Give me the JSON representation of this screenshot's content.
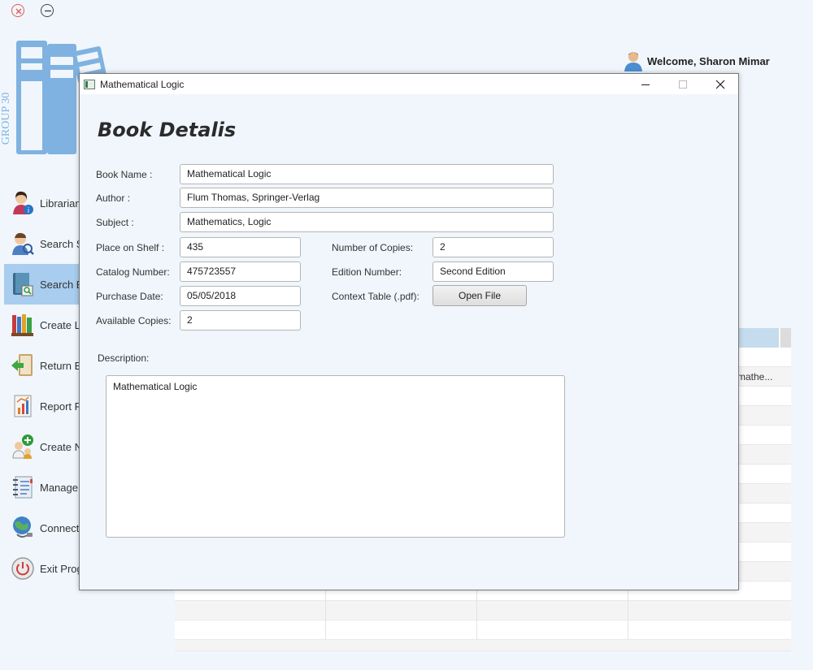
{
  "app": {
    "logo_text": "GROUP 30",
    "welcome": "Welcome, Sharon Mimar",
    "sidebar": [
      {
        "label": "Librarian",
        "icon": "librarian-info-icon",
        "active": false
      },
      {
        "label": "Search Su",
        "icon": "search-user-icon",
        "active": false
      },
      {
        "label": "Search Bo",
        "icon": "search-book-icon",
        "active": true
      },
      {
        "label": "Create Lo",
        "icon": "books-shelf-icon",
        "active": false
      },
      {
        "label": "Return Bo",
        "icon": "return-book-icon",
        "active": false
      },
      {
        "label": "Report Fa",
        "icon": "report-chart-icon",
        "active": false
      },
      {
        "label": "Create Ne",
        "icon": "create-user-icon",
        "active": false
      },
      {
        "label": "Manage (",
        "icon": "notebook-icon",
        "active": false
      },
      {
        "label": "Connecti",
        "icon": "connection-globe-icon",
        "active": false
      },
      {
        "label": "Exit Progr",
        "icon": "power-icon",
        "active": false
      }
    ],
    "table_partial_text": "mathe..."
  },
  "dialog": {
    "title": "Mathematical Logic",
    "heading": "Book Detalis",
    "fields": {
      "book_name": {
        "label": "Book Name :",
        "value": "Mathematical Logic"
      },
      "author": {
        "label": "Author :",
        "value": "Flum Thomas, Springer-Verlag"
      },
      "subject": {
        "label": "Subject :",
        "value": "Mathematics, Logic"
      },
      "place_on_shelf": {
        "label": "Place on Shelf :",
        "value": "435"
      },
      "catalog_number": {
        "label": "Catalog Number:",
        "value": "475723557"
      },
      "purchase_date": {
        "label": "Purchase Date:",
        "value": "05/05/2018"
      },
      "available_copies": {
        "label": "Available Copies:",
        "value": "2"
      },
      "number_of_copies": {
        "label": "Number of Copies:",
        "value": "2"
      },
      "edition_number": {
        "label": "Edition Number:",
        "value": "Second Edition"
      },
      "context_table": {
        "label": "Context Table (.pdf):",
        "button": "Open File"
      }
    },
    "description": {
      "label": "Description:",
      "value": "Mathematical Logic"
    }
  }
}
